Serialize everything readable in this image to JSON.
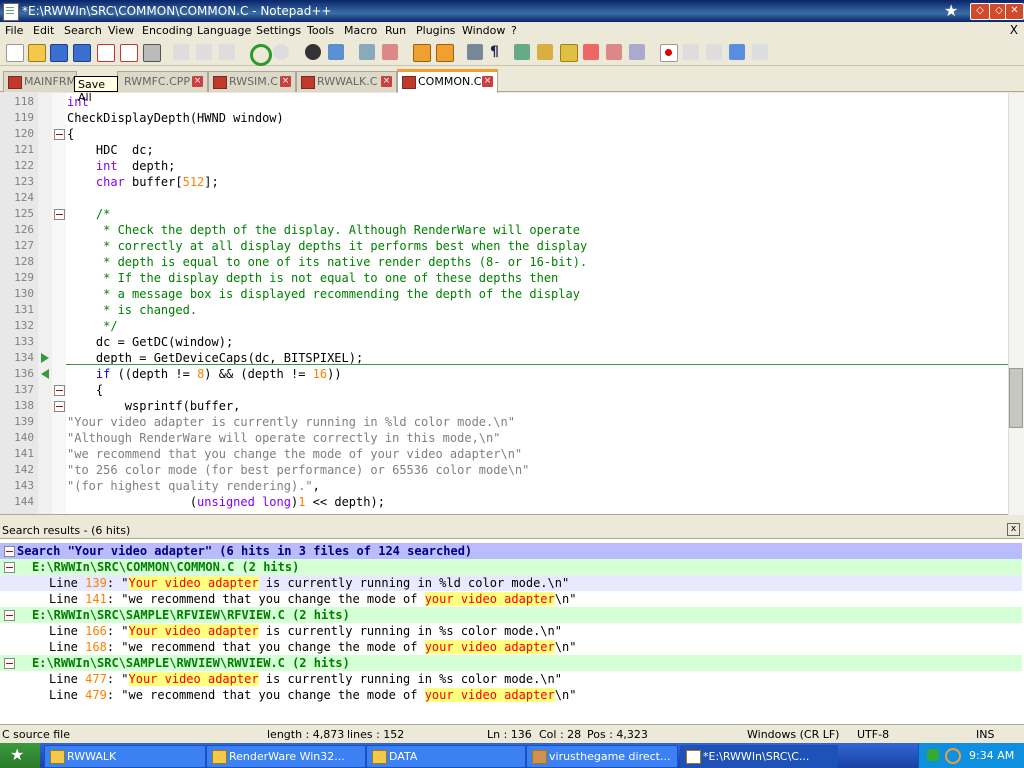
{
  "window": {
    "title": "*E:\\RWWIn\\SRC\\COMMON\\COMMON.C - Notepad++",
    "menu": [
      "File",
      "Edit",
      "Search",
      "View",
      "Encoding",
      "Language",
      "Settings",
      "Tools",
      "Macro",
      "Run",
      "Plugins",
      "Window",
      "?"
    ],
    "menu_close": "X"
  },
  "toolbar": {
    "tooltip": "Save All",
    "icons": [
      "new-file-icon",
      "open-file-icon",
      "save-icon",
      "save-all-icon",
      "close-icon",
      "close-all-icon",
      "print-icon",
      "cut-icon",
      "copy-icon",
      "paste-icon",
      "undo-icon",
      "redo-icon",
      "find-icon",
      "replace-icon",
      "zoom-in-icon",
      "zoom-out-icon",
      "sync-v-icon",
      "sync-h-icon",
      "wrap-icon",
      "all-chars-icon",
      "indent-guide-icon",
      "udl-icon",
      "doc-map-icon",
      "function-list-icon",
      "folder-workspace-icon",
      "monitor-icon",
      "record-macro-icon",
      "stop-record-icon",
      "play-macro-icon",
      "run-macro-multiple-icon",
      "save-macro-icon"
    ]
  },
  "tabs": [
    {
      "label": "MAINFRM",
      "active": false
    },
    {
      "label": "RWMFC.CPP",
      "active": false
    },
    {
      "label": "RWSIM.C",
      "active": false
    },
    {
      "label": "RWWALK.C",
      "active": false
    },
    {
      "label": "COMMON.C",
      "active": true
    }
  ],
  "editor": {
    "lines": [
      {
        "n": "118",
        "code": "int"
      },
      {
        "n": "119",
        "code": "CheckDisplayDepth(HWND window)"
      },
      {
        "n": "120",
        "code": "{"
      },
      {
        "n": "121",
        "code": "    HDC  dc;"
      },
      {
        "n": "122",
        "code": "    int  depth;"
      },
      {
        "n": "123",
        "code": "    char buffer[512];"
      },
      {
        "n": "124",
        "code": ""
      },
      {
        "n": "125",
        "code": "    /*"
      },
      {
        "n": "126",
        "code": "     * Check the depth of the display. Although RenderWare will operate"
      },
      {
        "n": "127",
        "code": "     * correctly at all display depths it performs best when the display"
      },
      {
        "n": "128",
        "code": "     * depth is equal to one of its native render depths (8- or 16-bit)."
      },
      {
        "n": "129",
        "code": "     * If the display depth is not equal to one of these depths then"
      },
      {
        "n": "130",
        "code": "     * a message box is displayed recommending the depth of the display"
      },
      {
        "n": "131",
        "code": "     * is changed."
      },
      {
        "n": "132",
        "code": "     */"
      },
      {
        "n": "133",
        "code": "    dc = GetDC(window);"
      },
      {
        "n": "134",
        "code": "    depth = GetDeviceCaps(dc, BITSPIXEL);"
      },
      {
        "n": "136",
        "code": "    if ((depth != 8) && (depth != 16))"
      },
      {
        "n": "137",
        "code": "    {"
      },
      {
        "n": "138",
        "code": "        wsprintf(buffer,"
      },
      {
        "n": "139",
        "code": "\"Your video adapter is currently running in %ld color mode.\\n\""
      },
      {
        "n": "140",
        "code": "\"Although RenderWare will operate correctly in this mode,\\n\""
      },
      {
        "n": "141",
        "code": "\"we recommend that you change the mode of your video adapter\\n\""
      },
      {
        "n": "142",
        "code": "\"to 256 color mode (for best performance) or 65536 color mode\\n\""
      },
      {
        "n": "143",
        "code": "\"(for highest quality rendering).\","
      },
      {
        "n": "144",
        "code": "                 (unsigned long)1 << depth);"
      }
    ]
  },
  "search": {
    "panel_title": "Search results - (6 hits)",
    "close": "x",
    "header": "Search \"Your video adapter\" (6 hits in 3 files of 124 searched)",
    "files": [
      {
        "path": "E:\\RWWIn\\SRC\\COMMON\\COMMON.C (2 hits)",
        "hits": [
          {
            "line": "139",
            "pre": "\"",
            "match": "Your video adapter",
            "post": " is currently running in %ld color mode.\\n\""
          },
          {
            "line": "141",
            "pre": "\"we recommend that you change the mode of ",
            "match": "your video adapter",
            "post": "\\n\""
          }
        ]
      },
      {
        "path": "E:\\RWWIn\\SRC\\SAMPLE\\RFVIEW\\RFVIEW.C (2 hits)",
        "hits": [
          {
            "line": "166",
            "pre": "\"",
            "match": "Your video adapter",
            "post": " is currently running in %s color mode.\\n\""
          },
          {
            "line": "168",
            "pre": "\"we recommend that you change the mode of ",
            "match": "your video adapter",
            "post": "\\n\""
          }
        ]
      },
      {
        "path": "E:\\RWWIn\\SRC\\SAMPLE\\RWVIEW\\RWVIEW.C (2 hits)",
        "hits": [
          {
            "line": "477",
            "pre": "\"",
            "match": "Your video adapter",
            "post": " is currently running in %s color mode.\\n\""
          },
          {
            "line": "479",
            "pre": "\"we recommend that you change the mode of ",
            "match": "your video adapter",
            "post": "\\n\""
          }
        ]
      }
    ]
  },
  "status": {
    "filetype": "C source file",
    "length": "length : 4,873",
    "lines": "lines : 152",
    "ln": "Ln : 136",
    "col": "Col : 28",
    "pos": "Pos : 4,323",
    "eol": "Windows (CR LF)",
    "encoding": "UTF-8",
    "mode": "INS"
  },
  "taskbar": {
    "tasks": [
      "RWWALK",
      "RenderWare Win32...",
      "DATA",
      "virusthegame direct...",
      "*E:\\RWWIn\\SRC\\C..."
    ],
    "time": "9:34 AM"
  },
  "colors": {
    "keyword": "#0000ff",
    "type": "#8000ff",
    "number": "#ff8000",
    "comment": "#008000",
    "string": "#808080",
    "match_fg": "#ff0000",
    "match_bg": "#ffff80"
  }
}
